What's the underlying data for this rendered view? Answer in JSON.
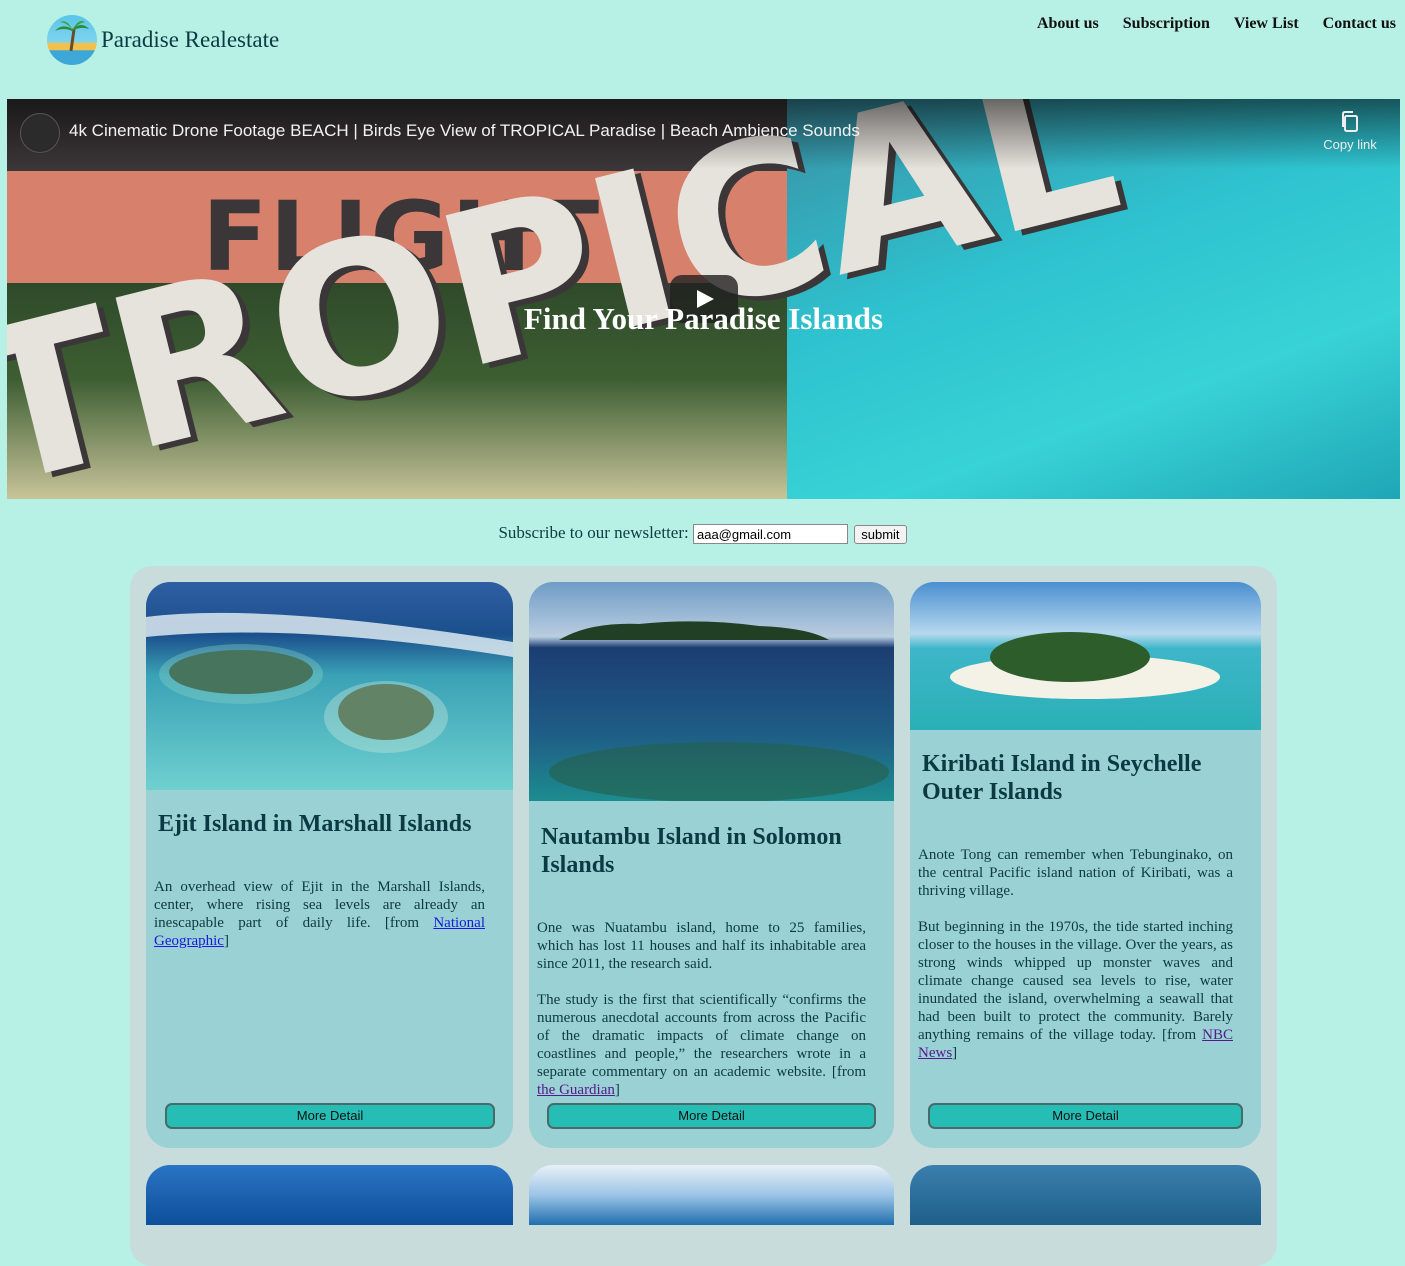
{
  "brand": {
    "name": "Paradise Realestate",
    "logo_icon": "palm-island-logo"
  },
  "nav": {
    "items": [
      "About us",
      "Subscription",
      "View List",
      "Contact us"
    ]
  },
  "hero": {
    "video_title": "4k Cinematic Drone Footage BEACH | Birds Eye View of TROPICAL Paradise | Beach Ambience Sounds",
    "copy_link_label": "Copy link",
    "thumbnail_word_top": "FLIGHT",
    "thumbnail_word_main": "TROPICAL",
    "tagline": "Find Your Paradise Islands"
  },
  "newsletter": {
    "label": "Subscribe to our newsletter:",
    "email_value": "aaa@gmail.com",
    "submit_label": "submit"
  },
  "cards": [
    {
      "title": "Ejit Island in Marshall Islands",
      "paragraphs": [
        "An overhead view of Ejit in the Marshall Islands, center, where rising sea levels are already an inescapable part of daily life. [from "
      ],
      "link_text": "National Geographic",
      "link_suffix": "]",
      "button": "More Detail"
    },
    {
      "title": "Nautambu Island in Solomon Islands",
      "paragraphs": [
        "One was Nuatambu island, home to 25 families, which has lost 11 houses and half its inhabitable area since 2011, the research said.",
        "The study is the first that scientifically “confirms the numerous anecdotal accounts from across the Pacific of the dramatic impacts of climate change on coastlines and people,” the researchers wrote in a separate commentary on an academic website. [from "
      ],
      "link_text": "the Guardian",
      "link_suffix": "]",
      "button": "More Detail"
    },
    {
      "title": "Kiribati Island in Seychelle Outer Islands",
      "paragraphs": [
        "Anote Tong can remember when Tebunginako, on the central Pacific island nation of Kiribati, was a thriving village.",
        "But beginning in the 1970s, the tide started inching closer to the houses in the village. Over the years, as strong winds whipped up monster waves and climate change caused sea levels to rise, water inundated the island, overwhelming a seawall that had been built to protect the community. Barely anything remains of the village today. [from "
      ],
      "link_text": "NBC News",
      "link_suffix": "]",
      "button": "More Detail"
    }
  ],
  "colors": {
    "page_bg": "#b7f0e4",
    "card_bg": "#9ad1d4",
    "button_bg": "#26bdb5"
  }
}
